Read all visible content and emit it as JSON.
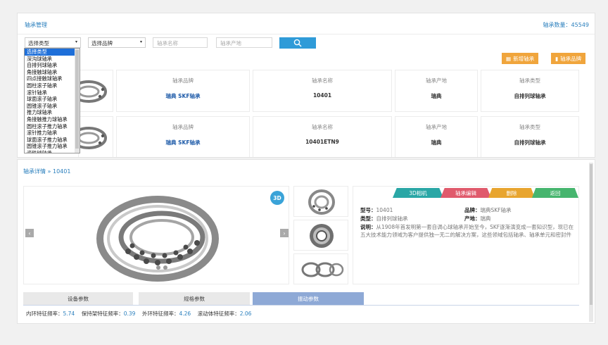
{
  "header": {
    "title": "轴承管理",
    "count_label": "轴承数量：",
    "count_value": "45549"
  },
  "filters": {
    "type_select": "选择类型",
    "brand_select": "选择品牌",
    "name_placeholder": "轴承名称",
    "origin_placeholder": "轴承产地"
  },
  "actions": {
    "new_bearing": "新增轴承",
    "bearing_brand": "轴承品牌"
  },
  "dropdown_options": [
    "选择类型",
    "深沟球轴承",
    "自排列球轴承",
    "角接触球轴承",
    "四点接触球轴承",
    "圆柱滚子轴承",
    "滚针轴承",
    "球面滚子轴承",
    "圆锥滚子轴承",
    "推力球轴承",
    "角接触推力球轴承",
    "圆柱滚子推力轴承",
    "滚针推力轴承",
    "球面滚子推力轴承",
    "圆锥滚子推力轴承",
    "滚珠球轴承"
  ],
  "list_columns": {
    "brand": "轴承品牌",
    "name": "轴承名称",
    "origin": "轴承产地",
    "type": "轴承类型"
  },
  "list_rows": [
    {
      "brand": "瑞典 SKF轴承",
      "name": "10401",
      "origin": "瑞典",
      "type": "自排列球轴承"
    },
    {
      "brand": "瑞典 SKF轴承",
      "name": "10401ETN9",
      "origin": "瑞典",
      "type": "自排列球轴承"
    }
  ],
  "detail": {
    "breadcrumb_root": "轴承详情",
    "breadcrumb_sep": "»",
    "breadcrumb_item": "10401",
    "badge": "3D",
    "prev": "‹",
    "next": "›",
    "tabs": [
      {
        "label": "3D相机",
        "color": "#2aa7a6"
      },
      {
        "label": "轴承编辑",
        "color": "#e05a6c"
      },
      {
        "label": "删除",
        "color": "#e8a52f"
      },
      {
        "label": "返回",
        "color": "#46b56e"
      }
    ],
    "model_label": "型号：",
    "model_value": "10401",
    "brand_label": "品牌：",
    "brand_value": "瑞典SKF轴承",
    "type_label": "类型：",
    "type_value": "自排列球轴承",
    "origin_label": "产地：",
    "origin_value": "瑞典",
    "desc_label": "说明：",
    "desc_text": "从1908年首发明第一套自调心球轴承开始至今，SKF逐渐演变成一套知识型，现已在五大技术能力领域为客户提供独一无二的解决方案，这些领域包括轴承、轴承单元和密封件"
  },
  "param_tabs": [
    "设备参数",
    "规格参数",
    "振动参数"
  ],
  "params": [
    {
      "label": "内环特征频率：",
      "value": "5.74"
    },
    {
      "label": "保持架特征频率：",
      "value": "0.39"
    },
    {
      "label": "外环特征频率：",
      "value": "4.26"
    },
    {
      "label": "滚动体特征频率：",
      "value": "2.06"
    }
  ],
  "colors": {
    "accent": "#2a7fbd",
    "search": "#2f9bd8",
    "orange": "#f0a53c",
    "active_tab": "#8ea9d6"
  }
}
